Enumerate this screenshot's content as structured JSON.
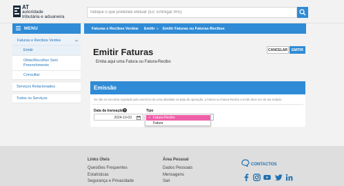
{
  "header": {
    "logo": {
      "mark": "AT",
      "line1": "autoridade",
      "line2": "tributária e aduaneira"
    },
    "search_placeholder": "Indique o que pretende efetuar (Ex: Entregar IRS)"
  },
  "menu": {
    "label": "MENU"
  },
  "sidebar": {
    "items": [
      {
        "label": "Faturas e Recibos Verdes"
      },
      {
        "label": "Emitir"
      },
      {
        "label": "Obter/Recolher Sem",
        "label2": "Preenchimento"
      },
      {
        "label": "Consultar"
      },
      {
        "label": "Serviços Relacionados"
      },
      {
        "label": "Todos os Serviços"
      }
    ]
  },
  "breadcrumb": {
    "items": [
      "Faturas e Recibos Verdes",
      "Emitir",
      "Emitir Faturas ou Faturas-Recibos"
    ],
    "separator": "»"
  },
  "main": {
    "title": "Emitir Faturas",
    "subtitle": "Emita aqui uma Fatura ou Fatura-Recibo",
    "cancel_label": "CANCELAR",
    "emit_label": "EMITIR"
  },
  "card": {
    "title": "Emissão",
    "note": "Se não se encontra registado pelo exercício de uma atividade na data da operação, a Fatura ou Fatura-Recibo a emitir deve ser de ato isolado.",
    "date_label": "Data da transação",
    "date_value": "2024-10-03",
    "tipo_label": "Tipo",
    "tipo_options": [
      "Fatura-Recibo",
      "Fatura"
    ],
    "tipo_selected": "Fatura-Recibo"
  },
  "footer": {
    "col1": {
      "heading": "Links Úteis",
      "links": [
        "Questões Frequentes",
        "Estatísticas",
        "Segurança e Privacidade"
      ]
    },
    "col2": {
      "heading": "Área Pessoal",
      "links": [
        "Dados Pessoais",
        "Mensagens",
        "Sair"
      ]
    },
    "contact_label": "CONTACTOS",
    "social_icons": [
      "facebook-icon",
      "instagram-icon",
      "youtube-icon",
      "twitter-icon",
      "linkedin-icon"
    ]
  },
  "colors": {
    "accent": "#2f8bd6",
    "highlight": "#ef5fa7",
    "background": "#f2f2f2"
  }
}
